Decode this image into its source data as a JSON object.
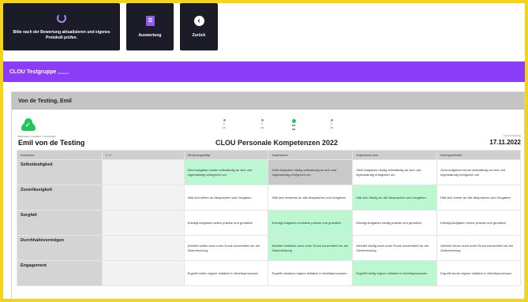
{
  "toolbar": {
    "buttons": [
      {
        "icon": "refresh-icon",
        "label": "Bitte nach der Bewertung aktualisieren und eigenes Protokoll prüfen."
      },
      {
        "icon": "document-icon",
        "label": "Auswertung"
      },
      {
        "icon": "back-icon",
        "label": "Zurück"
      }
    ]
  },
  "header": {
    "title": "CLOU Testgruppe",
    "subtitle": "Mitarbeiter"
  },
  "panel": {
    "title": "Von de Testing, Emil",
    "status_small": "Bearbeitet | Freigeben | Verschoben",
    "person_name": "Emil von de Testing",
    "doc_title": "CLOU Personale Kompetenzen 2022",
    "date_label": "Letzte Änderung",
    "date_value": "17.11.2022",
    "scale": [
      {
        "top": "0",
        "bottom": "1/4"
      },
      {
        "top": "1",
        "bottom": "2/4"
      },
      {
        "top": "2/4",
        "bottom": "3/4"
      },
      {
        "top": "3",
        "bottom": "4/4"
      }
    ]
  },
  "table": {
    "headers": [
      "Kompetenz",
      "1 / 4",
      "Wenig ausgeprägt",
      "Angemessen",
      "Angemessen plus",
      "Außergewöhnlich"
    ],
    "rows": [
      {
        "criterion": "Selbständigkeit",
        "note": "",
        "cells": [
          "Zieht Aufgaben selten selbständig an sich und eigenständig erfolgreich um",
          "Zieht Aufgaben häufig selbständig an sich und eigenständig erfolgreich um",
          "Zieht Aufgaben häufig selbständig an sich und eigenständig erfolgreich um",
          "Zieht Aufgaben immer selbständig an sich und eigenständig erfolgreich um"
        ]
      },
      {
        "criterion": "Zuverlässigkeit",
        "note": "",
        "cells": [
          "Hält sich selten an Absprachen und Vorgaben",
          "Hält sich meistens an alle Absprachen und Vorgaben",
          "Hält sich häufig an alle Absprachen und Vorgaben",
          "Hält sich immer an alle Absprachen und Vorgaben"
        ]
      },
      {
        "criterion": "Sorgfalt",
        "note": "",
        "cells": [
          "Erledigt Aufgaben selten präzise und gründlich",
          "Erledigt Aufgaben meistens präzise und gründlich",
          "Erledigt Aufgaben häufig präzise und gründlich",
          "Erledigt Aufgaben immer präzise und gründlich"
        ]
      },
      {
        "criterion": "Durchhaltevermögen",
        "note": "",
        "cells": [
          "Arbeitet selten auch unter Druck konzentriert an der Zielerreichung",
          "Arbeitet meistens auch unter Druck konzentriert an der Zielerreichung",
          "Arbeitet häufig auch unter Druck konzentriert an der Zielerreichung",
          "Arbeitet immer auch unter Druck konzentriert an der Zielerreichung"
        ]
      },
      {
        "criterion": "Engagement",
        "note": "",
        "cells": [
          "Ergreift selten eigene Initiative in Arbeitsprozessen",
          "Ergreift meistens eigene Initiative in Arbeitsprozessen",
          "Ergreift häufig eigene Initiative in Arbeitsprozessen",
          "Ergreift immer eigene Initiative in Arbeitsprozessen"
        ]
      }
    ]
  }
}
